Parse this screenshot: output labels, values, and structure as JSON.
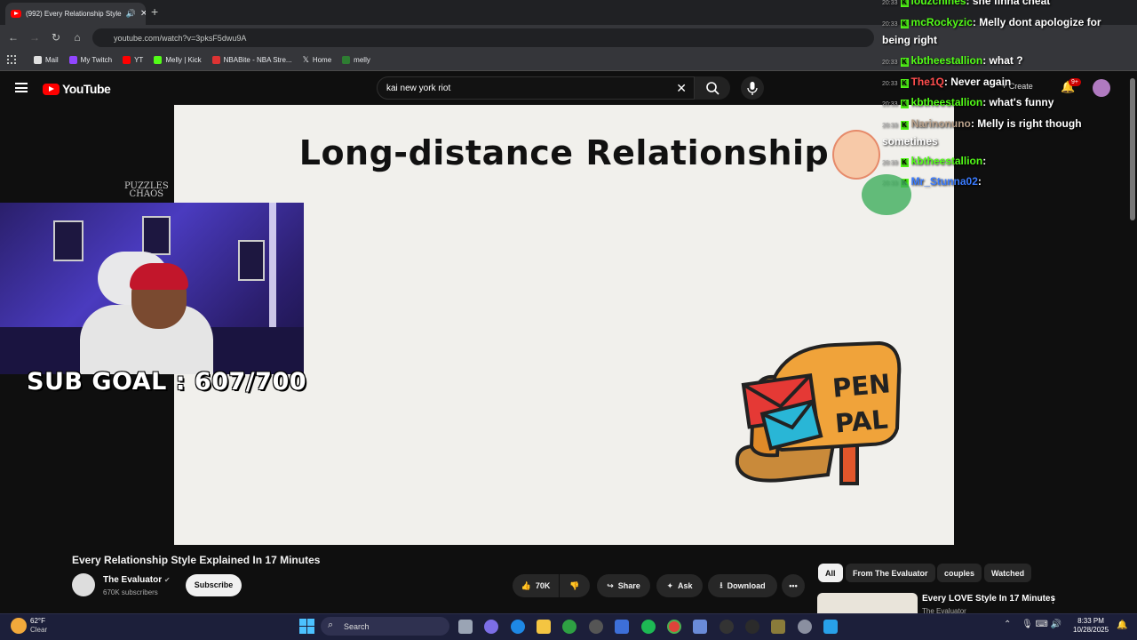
{
  "browser": {
    "tab_title": "(992) Every Relationship Style",
    "url": "youtube.com/watch?v=3pksF5dwu9A",
    "bookmarks": [
      "Mail",
      "My Twitch",
      "YT",
      "Melly | Kick",
      "NBABite - NBA Stre...",
      "Home",
      "melly"
    ]
  },
  "youtube": {
    "logo": "YouTube",
    "search_query": "kai new york riot",
    "create_label": "Create",
    "notif_count": "9+"
  },
  "video": {
    "slide_title": "Long-distance Relationship",
    "mailbox_text_1": "PEN",
    "mailbox_text_2": "PAL",
    "title": "Every Relationship Style Explained In 17 Minutes",
    "channel": "The Evaluator",
    "subscribers": "670K subscribers",
    "subscribe_label": "Subscribe",
    "likes": "70K",
    "share_label": "Share",
    "ask_label": "Ask",
    "download_label": "Download"
  },
  "stream_overlay": {
    "sub_goal": "SUB GOAL : 607/700",
    "logo_line1": "PUZZLES",
    "logo_line2": "CHAOS"
  },
  "chips": [
    "All",
    "From The Evaluator",
    "couples",
    "Watched"
  ],
  "sidebar_video": {
    "title": "Every LOVE Style In 17 Minutes",
    "channel": "The Evaluator"
  },
  "chat": [
    {
      "time": "20:33",
      "user": "louzchines",
      "color": "#53fc18",
      "msg": ": she finna cheat"
    },
    {
      "time": "20:33",
      "user": "mcRockyzic",
      "color": "#53fc18",
      "msg": ": Melly dont apologize for"
    },
    {
      "time": "",
      "user": "",
      "color": "#fff",
      "msg": "being right"
    },
    {
      "time": "20:33",
      "user": "kbtheestallion",
      "color": "#53fc18",
      "msg": ": what ?"
    },
    {
      "time": "20:33",
      "user": "The1Q",
      "color": "#ff4d4d",
      "msg": ": Never again"
    },
    {
      "time": "20:33",
      "user": "kbtheestallion",
      "color": "#53fc18",
      "msg": ": what's funny"
    },
    {
      "time": "20:33",
      "user": "Narinonuno",
      "color": "#b8a08a",
      "msg": ": Melly is right though"
    },
    {
      "time": "",
      "user": "",
      "color": "#fff",
      "msg": "sometimes"
    },
    {
      "time": "20:33",
      "user": "kbtheestallion",
      "color": "#53fc18",
      "msg": ":"
    },
    {
      "time": "20:33",
      "user": "Mr_Stunna02",
      "color": "#3a7bff",
      "msg": ":"
    }
  ],
  "taskbar": {
    "weather_temp": "62°F",
    "weather_desc": "Clear",
    "search_label": "Search",
    "time": "8:33 PM",
    "date": "10/28/2025"
  }
}
